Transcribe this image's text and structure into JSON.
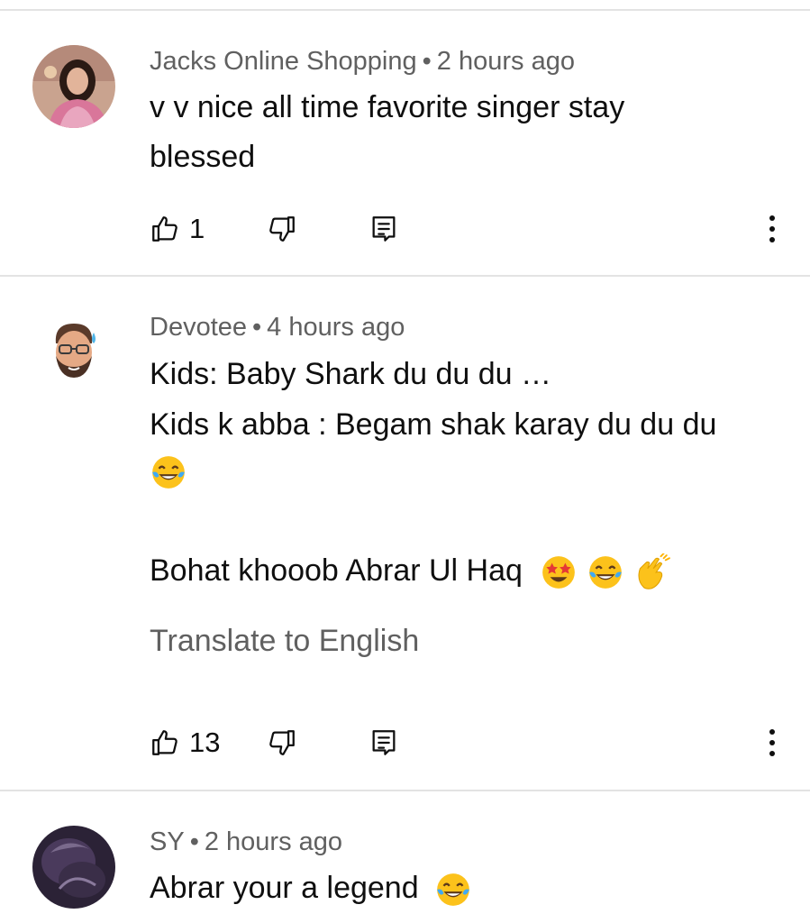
{
  "comments": [
    {
      "author": "Jacks Online Shopping",
      "dot": "•",
      "time": "2 hours ago",
      "lines": [
        "v v nice all time favorite singer stay",
        "blessed"
      ],
      "likes": "1",
      "avatar": "woman-photo-avatar"
    },
    {
      "author": "Devotee",
      "dot": "•",
      "time": "4 hours ago",
      "lines": [
        "Kids:  Baby Shark du du du …",
        "Kids k abba :  Begam shak karay du du du",
        "Bohat khooob Abrar Ul Haq"
      ],
      "translate": "Translate to English",
      "likes": "13",
      "avatar": "memoji-avatar"
    },
    {
      "author": "SY",
      "dot": "•",
      "time": "2 hours ago",
      "lines": [
        "Abrar your a legend"
      ],
      "avatar": "dark-photo-avatar"
    }
  ],
  "colors": {
    "text": "#0f0f0f",
    "secondary": "#606060",
    "divider": "#e3e3e3"
  },
  "icons": [
    "like-icon",
    "dislike-icon",
    "reply-icon",
    "more-vert-icon",
    "tears-of-joy-emoji",
    "star-struck-emoji",
    "clapping-hands-emoji"
  ]
}
